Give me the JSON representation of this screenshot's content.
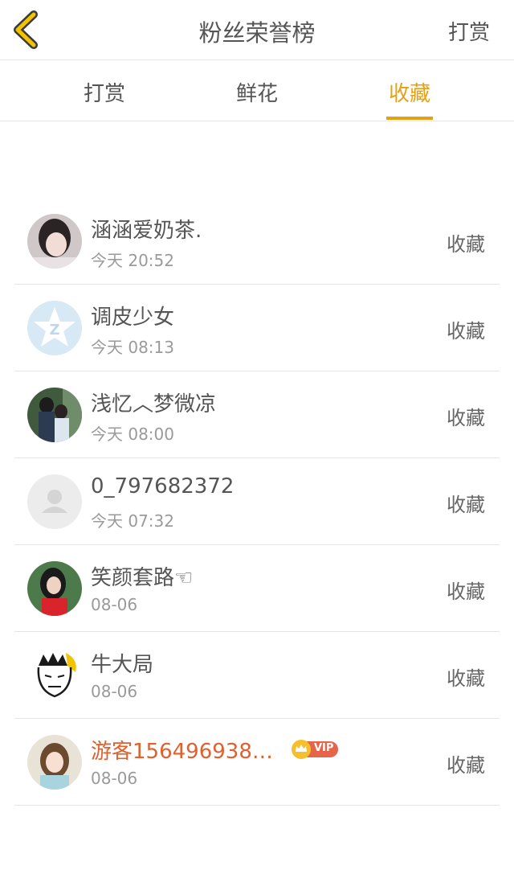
{
  "header": {
    "title": "粉丝荣誉榜",
    "action_label": "打赏"
  },
  "tabs": [
    {
      "label": "打赏"
    },
    {
      "label": "鲜花"
    },
    {
      "label": "收藏"
    }
  ],
  "list": [
    {
      "name": "涵涵爱奶茶.",
      "time": "今天 20:52",
      "action": "收藏"
    },
    {
      "name": "调皮少女",
      "time": "今天 08:13",
      "action": "收藏"
    },
    {
      "name": "浅忆︿梦微凉",
      "time": "今天 08:00",
      "action": "收藏"
    },
    {
      "name": "0_797682372",
      "time": "今天 07:32",
      "action": "收藏"
    },
    {
      "name": "笑颜套路☜",
      "time": "08-06",
      "action": "收藏"
    },
    {
      "name": "牛大局",
      "time": "08-06",
      "action": "收藏"
    },
    {
      "name": "游客156496938…",
      "time": "08-06",
      "action": "收藏",
      "badge": "VIP"
    }
  ],
  "colors": {
    "accent": "#e6a010",
    "guest_name": "#e0602e",
    "divider": "#e6e6e6"
  }
}
